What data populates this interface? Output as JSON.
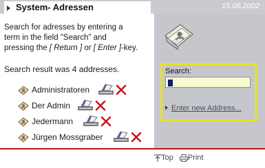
{
  "header": {
    "title": "System- Adressen",
    "date": "15.06.2002"
  },
  "intro": {
    "line1": "Search for adresses by entering a",
    "line2": "term in the field \"Search\" and",
    "line3_pre": "pressing the ",
    "line3_key1": "[ Return ]",
    "line3_mid": " or ",
    "line3_key2": "[ Enter ]",
    "line3_post": "-key."
  },
  "result": "Search result was 4 addresses.",
  "users": [
    {
      "name": "Administratoren"
    },
    {
      "name": "Der Admin"
    },
    {
      "name": "Jedermann"
    },
    {
      "name": "Jürgen Mossgraber"
    }
  ],
  "search": {
    "label": "Search:",
    "value": "",
    "new_address": "Enter new Address..."
  },
  "footer": {
    "top": "Top",
    "print": "Print"
  },
  "colors": {
    "accent": "#b01818",
    "sidebar": "#c5c7cd",
    "highlight": "#e7e321",
    "input": "#fafad2"
  },
  "icons": [
    "user-icon",
    "edit-icon",
    "delete-icon",
    "address-document-icon",
    "top-icon",
    "print-icon"
  ]
}
